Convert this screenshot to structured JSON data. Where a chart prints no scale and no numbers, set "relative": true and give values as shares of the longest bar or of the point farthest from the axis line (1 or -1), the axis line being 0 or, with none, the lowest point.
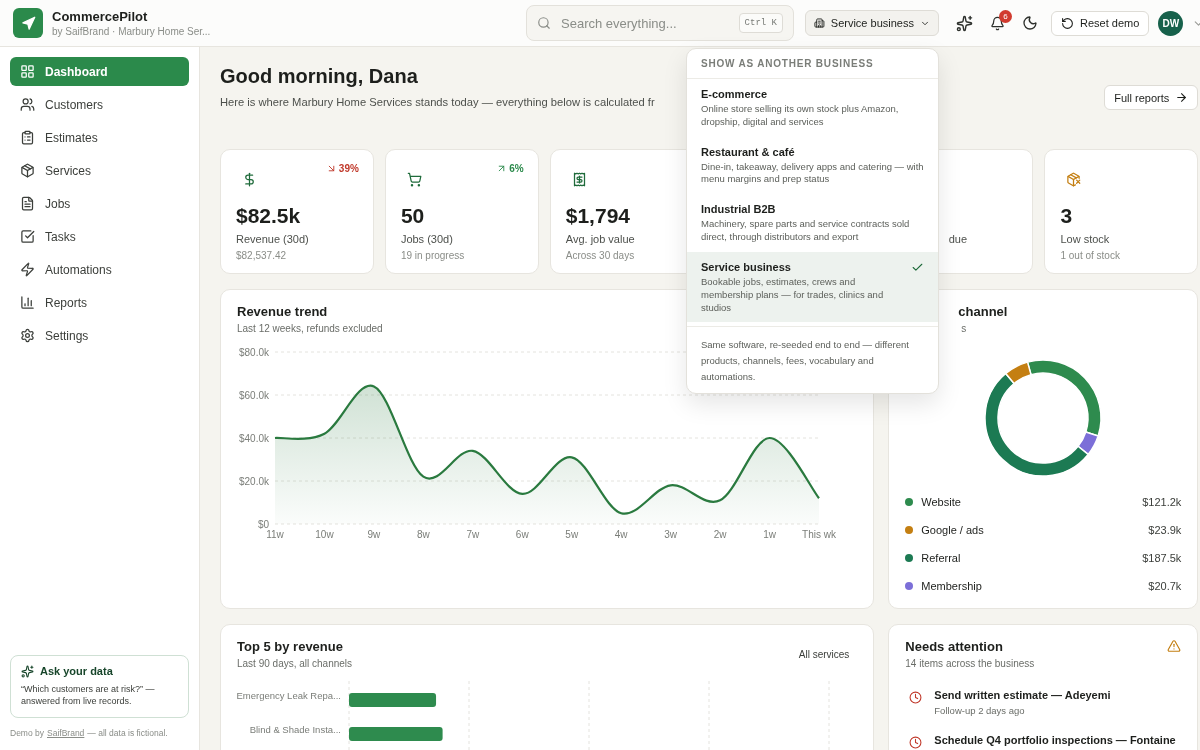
{
  "brand": {
    "name": "CommercePilot",
    "subtitle": "by SaifBrand · Marbury Home Ser..."
  },
  "search": {
    "placeholder": "Search everything...",
    "shortcut": "Ctrl K"
  },
  "business_select": {
    "label": "Service business",
    "expanded": true
  },
  "notifications": {
    "count": "6"
  },
  "reset_button": "Reset demo",
  "avatar": {
    "initials": "DW"
  },
  "business_menu": {
    "heading": "SHOW AS ANOTHER BUSINESS",
    "options": [
      {
        "title": "E-commerce",
        "description": "Online store selling its own stock plus Amazon, dropship, digital and services",
        "selected": false
      },
      {
        "title": "Restaurant & café",
        "description": "Dine-in, takeaway, delivery apps and catering — with menu margins and prep status",
        "selected": false
      },
      {
        "title": "Industrial B2B",
        "description": "Machinery, spare parts and service contracts sold direct, through distributors and export",
        "selected": false
      },
      {
        "title": "Service business",
        "description": "Bookable jobs, estimates, crews and membership plans — for trades, clinics and studios",
        "selected": true
      }
    ],
    "note": "Same software, re-seeded end to end — different products, channels, fees, vocabulary and automations."
  },
  "sidebar": {
    "items": [
      {
        "label": "Dashboard",
        "selected": true
      },
      {
        "label": "Customers",
        "selected": false
      },
      {
        "label": "Estimates",
        "selected": false
      },
      {
        "label": "Services",
        "selected": false
      },
      {
        "label": "Jobs",
        "selected": false
      },
      {
        "label": "Tasks",
        "selected": false
      },
      {
        "label": "Automations",
        "selected": false
      },
      {
        "label": "Reports",
        "selected": false
      },
      {
        "label": "Settings",
        "selected": false
      }
    ],
    "ask_card": {
      "title": "Ask your data",
      "text": "“Which customers are at risk?” — answered from live records."
    },
    "footer": {
      "before": "Demo by",
      "link": "SaifBrand",
      "after": "— all data is fictional."
    }
  },
  "greeting": {
    "title": "Good morning, Dana",
    "subtitle": "Here is where Marbury Home Services stands today — everything below is calculated fr"
  },
  "full_reports_button": "Full reports",
  "stat_cards": [
    {
      "kind": "stat",
      "value": "$82.5k",
      "label": "Revenue (30d)",
      "detail": "$82,537.42",
      "trend": {
        "falling": true,
        "text": "39%"
      }
    },
    {
      "kind": "stat",
      "value": "50",
      "label": "Jobs (30d)",
      "detail": "19 in progress",
      "trend": {
        "falling": false,
        "text": "6%"
      }
    },
    {
      "kind": "stat",
      "value": "$1,794",
      "label": "Avg. job value",
      "detail": "Across 30 days"
    },
    {
      "kind": "partial",
      "label": "due"
    },
    {
      "kind": "stat",
      "value": "3",
      "label": "Low stock",
      "detail": "1 out of stock"
    }
  ],
  "revenue_trend": {
    "title": "Revenue trend",
    "subtitle": "Last 12 weeks, refunds excluded",
    "chart_data": {
      "type": "area",
      "categories": [
        "11w",
        "10w",
        "9w",
        "8w",
        "7w",
        "6w",
        "5w",
        "4w",
        "3w",
        "2w",
        "1w",
        "This wk"
      ],
      "series": [
        {
          "color": "#2a7a3f",
          "values": [
            40,
            42,
            64,
            22,
            34,
            14,
            31,
            5,
            18,
            11,
            40,
            12
          ]
        }
      ],
      "ylim": [
        0,
        80
      ],
      "grid": true,
      "yticks": [
        {
          "value": 0,
          "label": "$0"
        },
        {
          "value": 20,
          "label": "$20.0k"
        },
        {
          "value": 40,
          "label": "$40.0k"
        },
        {
          "value": 60,
          "label": "$60.0k"
        },
        {
          "value": 80,
          "label": "$80.0k"
        }
      ]
    }
  },
  "channel_panel": {
    "kind": "partial",
    "title": "channel",
    "subtitle": "s",
    "chart_data": {
      "type": "donut",
      "categories": [
        "Website",
        "Google / ads",
        "Referral",
        "Membership"
      ],
      "series": [
        {
          "values": [
            34.3,
            6.8,
            53.1,
            5.8
          ]
        }
      ]
    },
    "legend": [
      {
        "value": "$121.2k",
        "color": "#2e8b4e"
      },
      {
        "value": "$23.9k",
        "color": "#c47f12"
      },
      {
        "value": "$187.5k",
        "color": "#1c7a53"
      },
      {
        "value": "$20.7k",
        "color": "#7c6fd8"
      }
    ]
  },
  "top_services": {
    "title": "Top 5 by revenue",
    "subtitle": "Last 90 days, all channels",
    "filter": "All services",
    "chart_data": {
      "type": "bar",
      "orientation": "horizontal",
      "relative": true,
      "categories": [
        "Emergency Leak Repa...",
        "Blind & Shade Insta..."
      ],
      "series": [
        {
          "color": "#2e8b4e",
          "values": [
            0.93,
            1
          ]
        }
      ]
    }
  },
  "needs_attention": {
    "title": "Needs attention",
    "subtitle": "14 items across the business",
    "items": [
      {
        "title": "Send written estimate — Adeyemi",
        "detail": "Follow-up 2 days ago"
      },
      {
        "title": "Schedule Q4 portfolio inspections — Fontaine"
      }
    ]
  }
}
